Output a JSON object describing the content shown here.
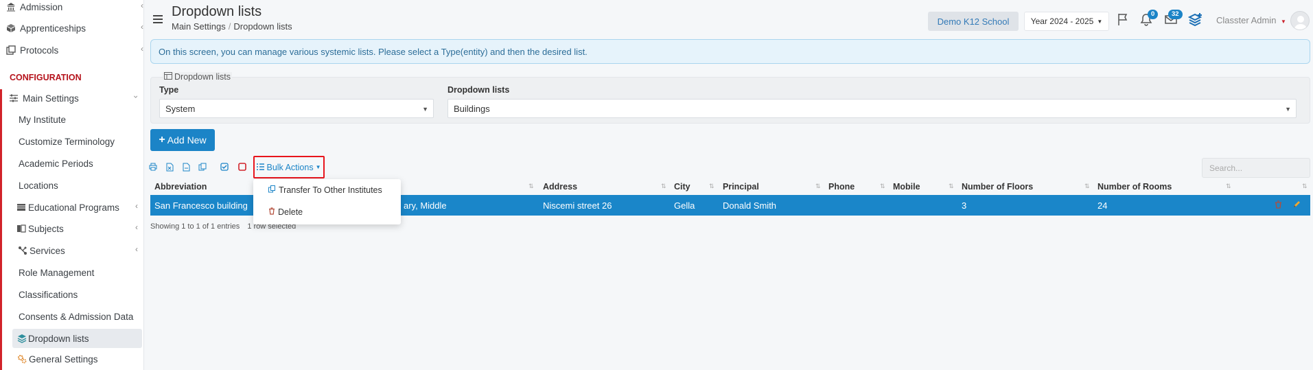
{
  "sidebar": {
    "items": [
      {
        "label": "Admission",
        "icon": "bank-icon"
      },
      {
        "label": "Apprenticeships",
        "icon": "box-icon"
      },
      {
        "label": "Protocols",
        "icon": "protocols-icon"
      }
    ],
    "section": "CONFIGURATION",
    "main_settings": "Main Settings",
    "sub_items": [
      {
        "label": "My Institute"
      },
      {
        "label": "Customize Terminology"
      },
      {
        "label": "Academic Periods"
      },
      {
        "label": "Locations"
      },
      {
        "label": "Educational Programs",
        "icon": "programs-icon"
      },
      {
        "label": "Subjects",
        "icon": "book-icon"
      },
      {
        "label": "Services",
        "icon": "services-icon"
      },
      {
        "label": "Role Management"
      },
      {
        "label": "Classifications"
      },
      {
        "label": "Consents & Admission Data"
      },
      {
        "label": "Dropdown lists",
        "icon": "layers-icon"
      },
      {
        "label": "General Settings",
        "icon": "gears-icon"
      }
    ]
  },
  "header": {
    "title": "Dropdown lists",
    "breadcrumb": [
      "Main Settings",
      "Dropdown lists"
    ],
    "school": "Demo K12 School",
    "year": "Year 2024 - 2025",
    "notifications_count": "0",
    "messages_count": "32",
    "user": "Classter Admin"
  },
  "info_text": "On this screen, you can manage various systemic lists. Please select a Type(entity) and then the desired list.",
  "filter": {
    "legend": "Dropdown lists",
    "type_label": "Type",
    "type_value": "System",
    "list_label": "Dropdown lists",
    "list_value": "Buildings"
  },
  "add_new": "Add New",
  "bulk_actions": "Bulk Actions",
  "bulk_menu": [
    "Transfer To Other Institutes",
    "Delete"
  ],
  "search_placeholder": "Search...",
  "table": {
    "columns": [
      "Abbreviation",
      "Address",
      "City",
      "Principal",
      "Phone",
      "Mobile",
      "Number of Floors",
      "Number of Rooms"
    ],
    "row": {
      "abbreviation": "San Francesco building",
      "levels": "ary, Middle",
      "address": "Niscemi street 26",
      "city": "Gella",
      "principal": "Donald Smith",
      "floors": "3",
      "rooms": "24"
    }
  },
  "showing_text": "Showing 1 to 1 of 1 entries",
  "selected_text": "1 row selected",
  "colors": {
    "accent": "#1b84c7",
    "danger": "#d1232a",
    "row_selected": "#1a86c9"
  }
}
